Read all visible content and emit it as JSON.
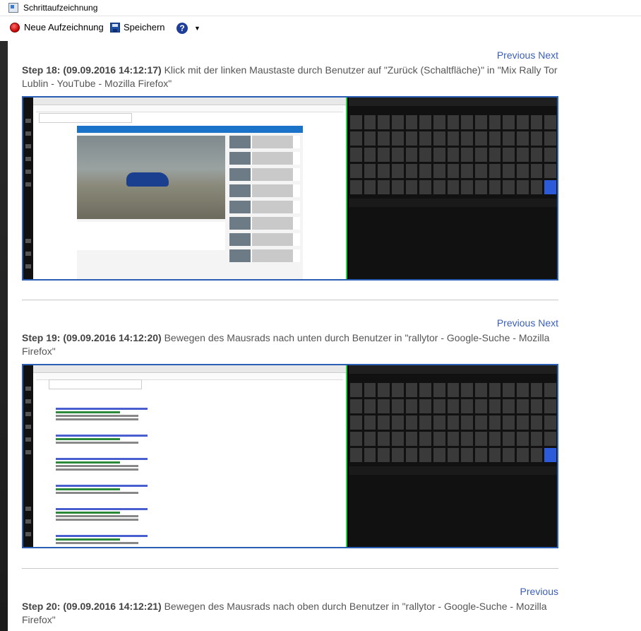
{
  "window": {
    "title": "Schrittaufzeichnung"
  },
  "toolbar": {
    "new_label": "Neue Aufzeichnung",
    "save_label": "Speichern",
    "help_glyph": "?",
    "dropdown_glyph": "▼"
  },
  "steps": [
    {
      "previous": "Previous",
      "next": "Next",
      "header": "Step 18: (09.09.2016 14:12:17)",
      "text": "Klick mit der linken Maustaste durch Benutzer auf \"Zurück (Schaltfläche)\" in \"Mix Rally Tor Lublin - YouTube - Mozilla Firefox\""
    },
    {
      "previous": "Previous",
      "next": "Next",
      "header": "Step 19: (09.09.2016 14:12:20)",
      "text": "Bewegen des Mausrads nach unten durch Benutzer in \"rallytor - Google-Suche - Mozilla Firefox\""
    },
    {
      "previous": "Previous",
      "header": "Step 20: (09.09.2016 14:12:21)",
      "text": "Bewegen des Mausrads nach oben durch Benutzer in \"rallytor - Google-Suche - Mozilla Firefox\""
    }
  ],
  "colors": {
    "link": "#3b5fb8",
    "frame": "#2b5fb4",
    "accent_green": "#31c84a"
  }
}
